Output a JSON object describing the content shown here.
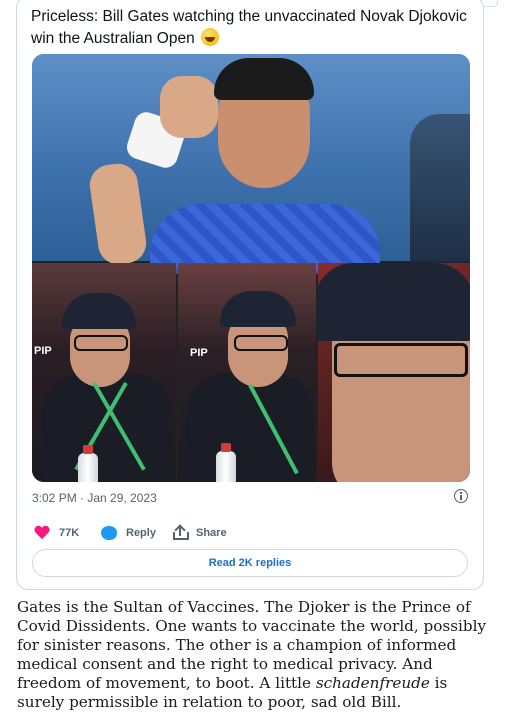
{
  "tweet": {
    "text_line1": "Priceless: Bill Gates watching the unvaccinated Novak Djokovic",
    "text_line2": "win the Australian Open",
    "emoji_icon": "rolling-on-floor-laughing-emoji",
    "timestamp": "3:02 PM · Jan 29, 2023",
    "likes": "77K",
    "reply_label": "Reply",
    "share_label": "Share",
    "read_replies_label": "Read 2K replies",
    "photo_labels": {
      "pip1": "PIP",
      "pip2": "PIP"
    }
  },
  "article": {
    "paragraph_before": "Gates is the Sultan of Vaccines. The Djoker is the Prince of Covid Dissidents. One wants to vaccinate the world, possibly for sinister reasons. The other is a champion of informed medical consent and the right to medical privacy. And freedom of movement, to boot. A little ",
    "emphasis": "schadenfreude",
    "paragraph_after": " is surely permissible in relation to poor, sad old Bill."
  },
  "colors": {
    "like": "#f91880",
    "reply": "#1d9bf0",
    "link": "#1d6fc9",
    "muted": "#536471"
  }
}
